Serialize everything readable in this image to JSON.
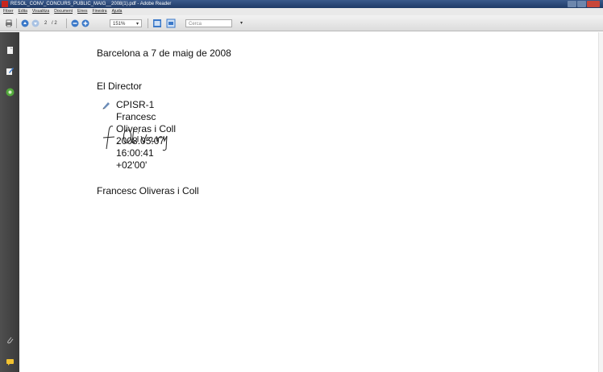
{
  "window": {
    "title": "RESOL_CONV_CONCURS_PUBLIC_MAIG__2008(1).pdf - Adobe Reader"
  },
  "menu": [
    "Fitxer",
    "Edita",
    "Visualitza",
    "Document",
    "Eines",
    "Finestra",
    "Ajuda"
  ],
  "toolbar": {
    "page_current": "2",
    "page_total": "/ 2",
    "zoom": "151%",
    "search_placeholder": "Cerca"
  },
  "document": {
    "date_line": "Barcelona a 7 de maig  de 2008",
    "role": "El Director",
    "signature": {
      "lines": [
        "CPISR-1",
        "Francesc",
        "Oliveras i Coll",
        "2008.05.07",
        "16:00:41",
        "+02'00'"
      ]
    },
    "signer_name": "Francesc Oliveras i Coll"
  },
  "colors": {
    "titlebar": "#2a4a7a",
    "panel": "#444444",
    "accent_blue": "#3a78c8"
  },
  "icons": [
    "printer-icon",
    "previous-page-icon",
    "next-page-icon",
    "zoom-out-icon",
    "zoom-in-icon",
    "fit-page-icon",
    "fit-width-icon",
    "pages-icon",
    "sign-icon",
    "attachments-icon",
    "comments-icon"
  ]
}
